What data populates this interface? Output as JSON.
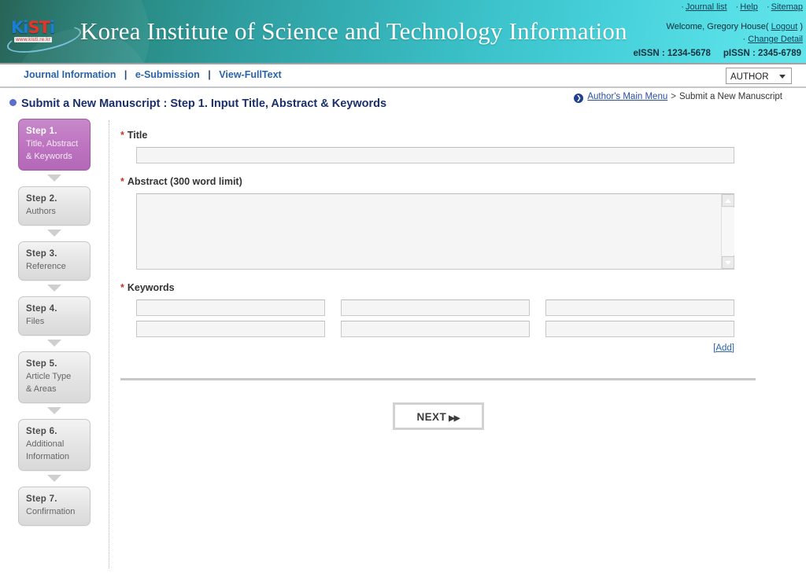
{
  "header": {
    "logo_text": "KiSTi",
    "logo_letters": [
      "K",
      "i",
      "S",
      "T",
      "i"
    ],
    "logo_url": "www.kisti.re.kr",
    "site_title": "Korea Institute of Science and Technology Information",
    "top_links": [
      {
        "label": "Journal list",
        "icon": "dot-separator"
      },
      {
        "label": "Help",
        "icon": "dot-separator"
      },
      {
        "label": "Sitemap",
        "icon": "dot-separator"
      }
    ],
    "welcome_prefix": "Welcome, Gregory House(",
    "welcome_user": "Gregory House",
    "logout_label": "Logout",
    "welcome_suffix": ")",
    "change_detail_label": "Change Detail",
    "change_detail_bullet": "·",
    "eissn": "eISSN : 1234-5678",
    "pissn": "pISSN : 2345-6789",
    "gradient_from": "#1d5b4e",
    "gradient_to": "#63e4ea"
  },
  "nav": {
    "items": [
      {
        "label": "Journal Information"
      },
      {
        "label": "e-Submission"
      },
      {
        "label": "View-FullText"
      }
    ],
    "separator": "|",
    "role_selected": "AUTHOR",
    "link_color": "#2a64ad"
  },
  "page": {
    "title": "Submit a New Manuscript : Step 1. Input Title, Abstract & Keywords",
    "title_color": "#1b2f6b",
    "bullet_color": "#5a6fd0"
  },
  "breadcrumb": {
    "icon_glyph": "❯",
    "home_label": "Author's Main Menu",
    "separator": ">",
    "current_label": "Submit a New Manuscript"
  },
  "sidebar": {
    "active_color": "#bd73c0",
    "steps": [
      {
        "num": "Step 1.",
        "desc_line1": "Title, Abstract",
        "desc_line2": "& Keywords",
        "active": true
      },
      {
        "num": "Step 2.",
        "desc_line1": "Authors",
        "desc_line2": "",
        "active": false
      },
      {
        "num": "Step 3.",
        "desc_line1": "Reference",
        "desc_line2": "",
        "active": false
      },
      {
        "num": "Step 4.",
        "desc_line1": "Files",
        "desc_line2": "",
        "active": false
      },
      {
        "num": "Step 5.",
        "desc_line1": "Article Type",
        "desc_line2": "& Areas",
        "active": false
      },
      {
        "num": "Step 6.",
        "desc_line1": "Additional",
        "desc_line2": "Information",
        "active": false
      },
      {
        "num": "Step 7.",
        "desc_line1": "Confirmation",
        "desc_line2": "",
        "active": false
      }
    ]
  },
  "form": {
    "required_mark": "*",
    "title_label": "Title",
    "title_value": "",
    "title_placeholder": "",
    "abstract_label": "Abstract (300 word limit)",
    "abstract_value": "",
    "abstract_placeholder": "",
    "keywords_label": "Keywords",
    "keywords": [
      "",
      "",
      "",
      "",
      "",
      ""
    ],
    "add_label": "[Add]",
    "next_label": "NEXT",
    "next_chevron": "▶▶"
  }
}
